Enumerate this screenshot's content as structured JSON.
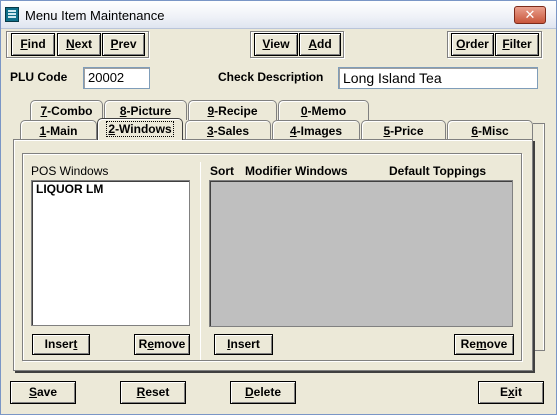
{
  "window": {
    "title": "Menu Item Maintenance",
    "close_glyph": "✕"
  },
  "toolbar": {
    "find": {
      "u": "F",
      "rest": "ind"
    },
    "next": {
      "u": "N",
      "rest": "ext"
    },
    "prev": {
      "u": "P",
      "rest": "rev"
    },
    "view": {
      "u": "V",
      "rest": "iew"
    },
    "add": {
      "u": "A",
      "rest": "dd"
    },
    "order": {
      "u": "O",
      "rest": "rder"
    },
    "filter": {
      "u": "F",
      "rest": "ilter"
    }
  },
  "fields": {
    "plu_label": "PLU Code",
    "plu_value": "20002",
    "desc_label": "Check Description",
    "desc_value": "Long Island Tea"
  },
  "tabs_back": [
    {
      "u": "7",
      "rest": "-Combo"
    },
    {
      "u": "8",
      "rest": "-Picture"
    },
    {
      "u": "9",
      "rest": "-Recipe"
    },
    {
      "u": "0",
      "rest": "-Memo"
    }
  ],
  "tabs_front": [
    {
      "u": "1",
      "rest": "-Main"
    },
    {
      "u": "2",
      "rest": "-Windows"
    },
    {
      "u": "3",
      "rest": "-Sales"
    },
    {
      "u": "4",
      "rest": "-Images"
    },
    {
      "u": "5",
      "rest": "-Price"
    },
    {
      "u": "6",
      "rest": "-Misc"
    }
  ],
  "windows_tab": {
    "pos_windows_label": "POS Windows",
    "pos_windows_items": [
      "LIQUOR LM"
    ],
    "sort_label": "Sort",
    "modifier_windows_label": "Modifier Windows",
    "default_toppings_label": "Default Toppings",
    "insert_left": {
      "pre": "Inser",
      "u": "t",
      "rest": ""
    },
    "remove_left": {
      "pre": "R",
      "u": "e",
      "rest": "move"
    },
    "insert_right": {
      "pre": "",
      "u": "I",
      "rest": "nsert"
    },
    "remove_right": {
      "pre": "Re",
      "u": "m",
      "rest": "ove"
    }
  },
  "footer": {
    "save": {
      "u": "S",
      "rest": "ave"
    },
    "reset": {
      "u": "R",
      "rest": "eset"
    },
    "delete": {
      "u": "D",
      "rest": "elete"
    },
    "exit": {
      "pre": "E",
      "u": "x",
      "rest": "it"
    }
  },
  "colors": {
    "title_bar": "#eef1f7",
    "face": "#ece9d8",
    "list_grey": "#bfbfbf",
    "close": "#c9563b"
  }
}
